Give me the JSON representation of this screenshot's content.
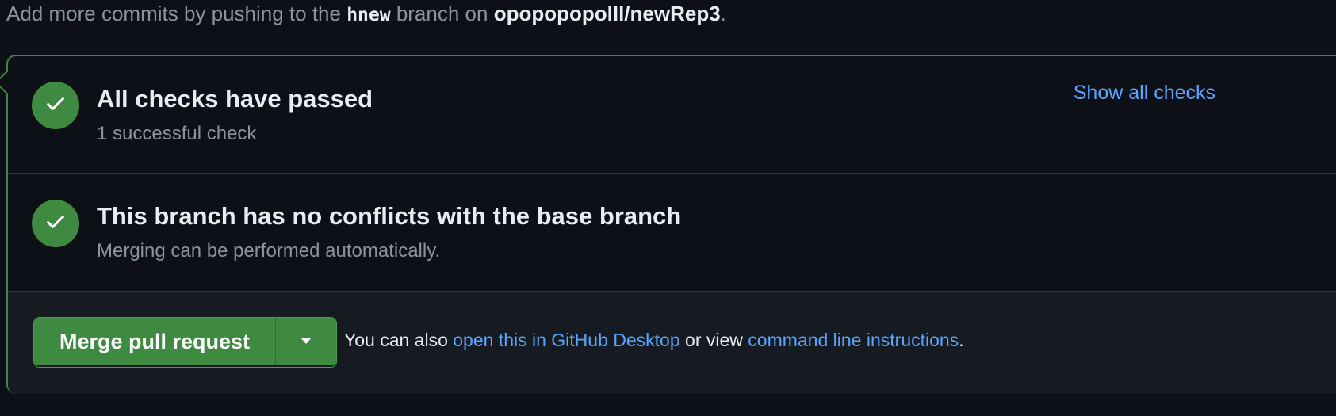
{
  "push_hint": {
    "prefix": "Add more commits by pushing to the ",
    "branch": "hnew",
    "middle": " branch on ",
    "repo": "opopopopolll/newRep3",
    "suffix": "."
  },
  "checks": {
    "title": "All checks have passed",
    "subtitle": "1 successful check",
    "show_all_label": "Show all checks",
    "status_icon": "check-icon"
  },
  "conflicts": {
    "title": "This branch has no conflicts with the base branch",
    "subtitle": "Merging can be performed automatically.",
    "status_icon": "check-icon"
  },
  "merge": {
    "button_label": "Merge pull request",
    "dropdown_icon": "triangle-down-icon",
    "note_prefix": "You can also ",
    "desktop_link": "open this in GitHub Desktop",
    "note_middle": " or view ",
    "cli_link": "command line instructions",
    "note_suffix": "."
  },
  "colors": {
    "background": "#0d1117",
    "success_green": "#3d8a40",
    "link_blue": "#58a6ff",
    "muted_text": "#8b949e"
  }
}
